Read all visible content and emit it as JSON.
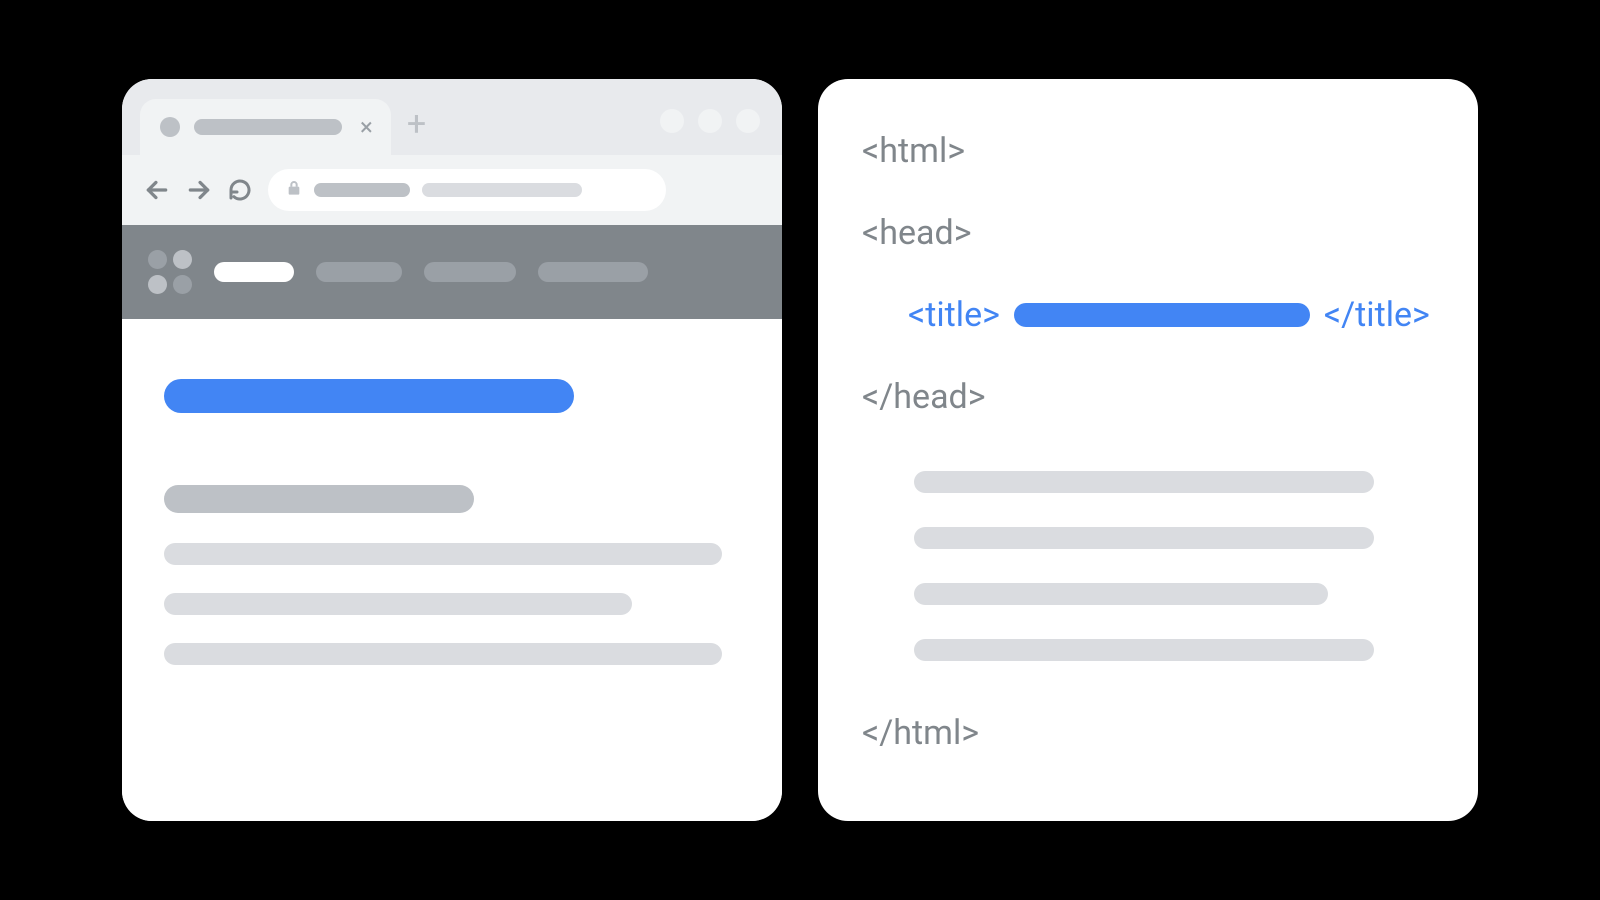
{
  "colors": {
    "blue": "#4285f4",
    "grey_text": "#80868b",
    "placeholder_light": "#dadce0",
    "placeholder_mid": "#bdc1c6",
    "nav_bg": "#80868b",
    "chrome_bg": "#f1f3f4",
    "tab_strip_bg": "#e8eaed"
  },
  "code": {
    "html_open": "<html>",
    "head_open": "<head>",
    "title_open": "<title>",
    "title_close": "</title>",
    "head_close": "</head>",
    "html_close": "</html>"
  }
}
